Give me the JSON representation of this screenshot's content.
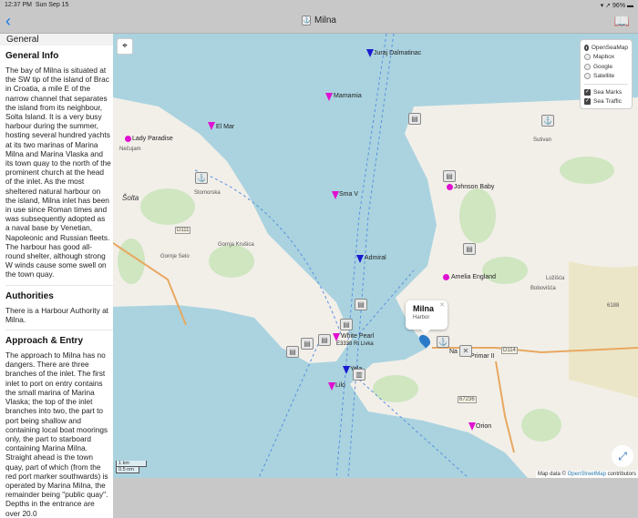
{
  "status": {
    "time": "12:37 PM",
    "date": "Sun Sep 15",
    "battery": "96%"
  },
  "nav": {
    "title": "Milna",
    "back_icon": "chevron-left",
    "book_icon": "book"
  },
  "sidebar": {
    "section": "General",
    "general_title": "General Info",
    "general_text": "The bay of Milna is situated at the SW tip of the island of Brac in Croatia, a mile E of the narrow channel that separates the island from its neighbour, Solta Island. It is a very busy harbour during the summer, hosting several hundred yachts at its two marinas of Marina Milna and Marina Vlaska and its town quay to the north of the prominent church at the head of the inlet. As the most sheltered natural harbour on the island, Milna inlet has been in use since Roman times and was subsequently adopted as a naval base by Venetian, Napoleonic and Russian fleets. The harbour has good all-round shelter, although strong W winds cause some swell on the town quay.",
    "authorities_title": "Authorities",
    "authorities_text": "There is a Harbour Authority at Milna.",
    "approach_title": "Approach & Entry",
    "approach_text": "The approach to Milna has no dangers. There are three branches of the inlet. The first inlet to port on entry contains the small marina of Marina Vlaska; the top of the inlet branches into two, the part to port being shallow and containing local boat moorings only, the part to starboard containing Marina Milna. Straight ahead is the town quay, part of which (from the red port marker southwards) is operated by Marina Milna, the remainder being \"public quay\". Depths in the entrance are over 20.0"
  },
  "layers": {
    "options": [
      "OpenSeaMap",
      "Mapbox",
      "Google",
      "Satellite"
    ],
    "selected": "OpenSeaMap",
    "overlays": [
      "Sea Marks",
      "Sea Traffic"
    ]
  },
  "vessels": [
    "Juraj Dalmatinac",
    "Mamamia",
    "El Mar",
    "Lady Paradise",
    "Sma V",
    "Johnson Baby",
    "Admiral",
    "Amelia England",
    "White Pearl",
    "Yela",
    "Lilo",
    "Primar II",
    "Orion",
    "Na"
  ],
  "places": [
    "Nečujam",
    "Šolta",
    "Stomorska",
    "D111",
    "Gornja Krušica",
    "Gornje Selo",
    "Sutivan",
    "Ložišća",
    "Bobovišća",
    "D114",
    "67236",
    "6188",
    "E3338 Rt Livka"
  ],
  "popup": {
    "name": "Milna",
    "type": "Harbor"
  },
  "scale": {
    "km": "1 km",
    "nm": "0.5 nm"
  },
  "attribution": {
    "prefix": "Map data ©",
    "link": "OpenStreetMap",
    "suffix": "contributors"
  },
  "colors": {
    "water": "#aad3df",
    "land": "#f2efe9",
    "accent": "#1a7ae8"
  }
}
